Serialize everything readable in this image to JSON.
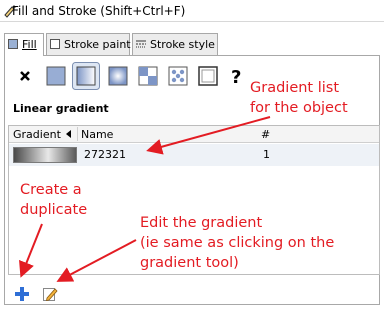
{
  "window": {
    "title": "Fill and Stroke (Shift+Ctrl+F)"
  },
  "tabs": [
    {
      "label": "Fill",
      "icon": "fill-swatch-icon",
      "active": true
    },
    {
      "label": "Stroke paint",
      "icon": "stroke-paint-swatch-icon",
      "active": false
    },
    {
      "label": "Stroke style",
      "icon": "stroke-style-icon",
      "active": false
    }
  ],
  "paint_types": [
    {
      "name": "no-paint-icon",
      "glyph": "✕"
    },
    {
      "name": "flat-color-icon"
    },
    {
      "name": "linear-gradient-icon",
      "selected": true
    },
    {
      "name": "radial-gradient-icon"
    },
    {
      "name": "pattern-icon"
    },
    {
      "name": "swatch-icon"
    },
    {
      "name": "frame-icon"
    },
    {
      "name": "unset-paint-icon",
      "glyph": "?"
    }
  ],
  "section": {
    "title": "Linear gradient"
  },
  "gradient_list": {
    "columns": {
      "gradient": "Gradient",
      "name": "Name",
      "count": "#"
    },
    "rows": [
      {
        "name": "272321",
        "count": "1"
      }
    ]
  },
  "actions": {
    "add_icon": "plus-icon",
    "edit_icon": "pencil-edit-icon"
  },
  "annotations": {
    "list": [
      "Gradient list",
      "for the object"
    ],
    "duplicate": [
      "Create a",
      "duplicate"
    ],
    "edit": [
      "Edit the gradient",
      "(ie same as clicking on the",
      "gradient tool)"
    ]
  },
  "colors": {
    "annotation": "#e31c23",
    "add_icon": "#2f6fd6",
    "selected_row": "#eef2f7"
  }
}
